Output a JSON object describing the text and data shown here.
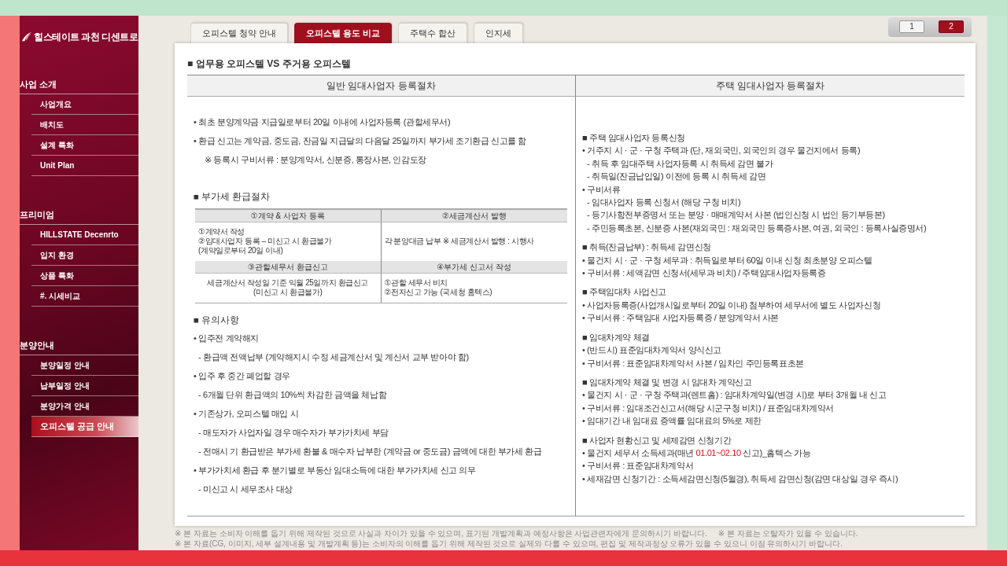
{
  "sidebar": {
    "logo": "힐스테이트 과천 디센트로",
    "groups": [
      {
        "title": "사업 소개",
        "items": [
          {
            "label": "사업개요",
            "selected": false
          },
          {
            "label": "배치도",
            "selected": false
          },
          {
            "label": "설계 특화",
            "selected": false
          },
          {
            "label": "Unit Plan",
            "selected": false
          }
        ]
      },
      {
        "title": "프리미엄",
        "items": [
          {
            "label": "HILLSTATE Decenrto",
            "selected": false
          },
          {
            "label": "입지 환경",
            "selected": false
          },
          {
            "label": "상품 특화",
            "selected": false
          },
          {
            "label": "#. 시세비교",
            "selected": false
          }
        ]
      },
      {
        "title": "분양안내",
        "items": [
          {
            "label": "분양일정 안내",
            "selected": false
          },
          {
            "label": "납부일정 안내",
            "selected": false
          },
          {
            "label": "분양가격 안내",
            "selected": false
          },
          {
            "label": "오피스텔 공급 안내",
            "selected": true
          }
        ]
      }
    ]
  },
  "tabs": [
    {
      "label": "오피스텔 청약 안내",
      "selected": false
    },
    {
      "label": "오피스텔 용도 비교",
      "selected": true
    },
    {
      "label": "주택수 합산",
      "selected": false
    },
    {
      "label": "인지세",
      "selected": false
    }
  ],
  "pager": [
    {
      "label": "1",
      "selected": false
    },
    {
      "label": "2",
      "selected": true
    }
  ],
  "title": "■ 업무용 오피스텔 VS 주거용 오피스텔",
  "left": {
    "heading": "일반 임대사업자 등록절차",
    "intro": [
      {
        "kind": "bullet",
        "text": "• 최초 분양계약금 지급일로부터 20일 이내에 사업자등록 (관할세무서)"
      },
      {
        "kind": "bullet",
        "text": "• 환급 신고는 계약금, 중도금, 잔금일 지급달의 다음달 25일까지 부가세 조기환급 신고를 함"
      },
      {
        "kind": "note",
        "text": "※ 등록시 구비서류 : 분양계약서, 신분증, 통장사본, 인감도장"
      }
    ],
    "refund_title": "■ 부가세 환급절차",
    "refund_table": [
      {
        "headers": [
          "①계약 & 사업자 등록",
          "②세금계산서 발행"
        ],
        "cells": [
          {
            "kind": "left",
            "lines": [
              "①계약서 작성",
              "②임대사업자 등록 – 미신고 시 환급불가",
              "(계약일로부터 20일 이내)"
            ]
          },
          {
            "kind": "left",
            "lines": [
              "각 분양대금 납부 ※ 세금계산서 발행 : 시행사"
            ]
          }
        ]
      },
      {
        "headers": [
          "③관할세무서 환급신고",
          "④부가세 신고서 작성"
        ],
        "cells": [
          {
            "kind": "center",
            "lines": [
              "세금계산서 작성일 기준 익월 25일까지 환급신고",
              "(미신고 시 환급불가)"
            ]
          },
          {
            "kind": "left",
            "lines": [
              "①관할 세무서 비치",
              "②전자신고 가능 (국세청 홈텍스)"
            ]
          }
        ]
      }
    ],
    "notice_title": "■ 유의사항",
    "notice": [
      {
        "kind": "bullet",
        "text": "• 입주전 계약해지"
      },
      {
        "kind": "dash",
        "text": "- 환급액 전액납부 (계약해지시 수정 세금계산서 및 계산서 교부 받아야 함)"
      },
      {
        "kind": "bullet",
        "text": "• 입주 후 중간 폐업할 경우"
      },
      {
        "kind": "dash",
        "text": "- 6개월 단위 환급액의 10%씩 차감한 금액을 체납함"
      },
      {
        "kind": "bullet",
        "text": "• 기존상가, 오피스텔 매입 시"
      },
      {
        "kind": "dash",
        "text": "- 매도자가 사업자일 경우 매수자가 부가가치세 부담"
      },
      {
        "kind": "dash",
        "text": "- 전매시 기 환급받은 부가세 환불 & 매수자 납부한 (계약금 or 중도금) 금액에 대한 부가세 환급"
      },
      {
        "kind": "bullet",
        "text": "• 부가가치세 환급 후 분기별로 부동산 임대소득에 대한 부가가치세 신고 의무"
      },
      {
        "kind": "dash",
        "text": "- 미신고 시 세무조사 대상"
      }
    ]
  },
  "right": {
    "heading": "주택 임대사업자 등록절차",
    "sections": [
      {
        "title": "■ 주택 임대사업자 등록신청",
        "lines": [
          {
            "kind": "bullet",
            "text": "• 거주지 시 · 군 · 구청 주택과 (단, 재외국민, 외국인의 경우 물건지에서 등록)"
          },
          {
            "kind": "dash",
            "text": "- 취득 후 임대주택 사업자등록 시 취득세 감면 불가"
          },
          {
            "kind": "dash",
            "text": "- 취득일(잔금납입일) 이전에 등록 시 취득세 감면"
          },
          {
            "kind": "bullet",
            "text": "• 구비서류"
          },
          {
            "kind": "dash",
            "text": "- 임대사업자 등록 신청서 (해당 구청 비치)"
          },
          {
            "kind": "dash",
            "text": "- 등기사항전부증명서 또는 분양 · 매매계약서 사본 (법인신청 시 법인 등기부등본)"
          },
          {
            "kind": "dash",
            "text": "- 주민등록초본, 신분증 사본(재외국민 : 재외국민 등록증사본, 여권, 외국인 : 등록사실증명서)"
          }
        ]
      },
      {
        "title": "■ 취득(잔금납부) : 취득세 감면신청",
        "lines": [
          {
            "kind": "bullet",
            "text": "• 물건지 시 · 군 · 구청 세무과 : 취득일로부터 60일 이내 신청 최초분양 오피스텔"
          },
          {
            "kind": "bullet",
            "text": "• 구비서류 : 세액감면 신청서(세무과 비치) / 주택임대사업자등록증"
          }
        ]
      },
      {
        "title": "■ 주택임대차 사업신고",
        "lines": [
          {
            "kind": "bullet",
            "text": "• 사업자등록증(사업개시일로부터 20일 이내) 첨부하여 세무서에 별도 사업자신청"
          },
          {
            "kind": "bullet",
            "text": "• 구비서류 : 주택임대 사업자등록증 / 분양계약서 사본"
          }
        ]
      },
      {
        "title": "■ 임대차계약 체결",
        "lines": [
          {
            "kind": "bullet",
            "text": "• (반드시) 표준임대차계약서 양식신고"
          },
          {
            "kind": "bullet",
            "text": "• 구비서류 : 표준임대차계약서 사본 / 임차인 주민등록표초본"
          }
        ]
      },
      {
        "title": "■ 임대차계약 체결 및 변경 시 임대차 계약신고",
        "lines": [
          {
            "kind": "bullet",
            "text": "• 물건지 시 · 군 · 구청 주택과(렌트홈) : 임대차계약일(변경 시)로 부터 3개월 내 신고"
          },
          {
            "kind": "bullet",
            "text": "• 구비서류 : 임대조건신고서(해당 시군구청 비치) / 표준임대차계약서"
          },
          {
            "kind": "bullet",
            "text": "• 임대기간 내 임대료 증액률 임대료의 5%로 제한"
          }
        ]
      },
      {
        "title": "■ 사업자 현황신고 및 세제감면 신청기간",
        "lines": [
          {
            "kind": "bullet",
            "text": "• 물건지 세무서 소득세과(매년 ",
            "highlight": "01.01~02.10",
            "after": " 신고)_홈텍스 가능"
          },
          {
            "kind": "bullet",
            "text": "• 구비서류 : 표준임대차계약서"
          },
          {
            "kind": "bullet",
            "text": "• 세재감면 신청기간 : 소득세감면신청(5월경), 취득세 감면신청(감면 대상일 경우 즉시)"
          }
        ]
      }
    ]
  },
  "notes": [
    "※ 본 자료는 소비자 이해를 돕기 위해 제작된 것으로 사실과 차이가 있을 수 있으며, 표기된 개발계획과 예정사항은 사업관련자에게 문의하시기 바랍니다.",
    "※ 본 자료는 오탈자가 있을 수 있습니다.",
    "※ 본 자료(CG, 이미지, 세부 설계내용 및 개발계획 등)는 소비자의 이해를 돕기 위해 제작된 것으로 실제와 다를 수 있으며, 편집 및 제작과정상 오류가 있을 수 있으니 이점 유의하시기 바랍니다."
  ]
}
